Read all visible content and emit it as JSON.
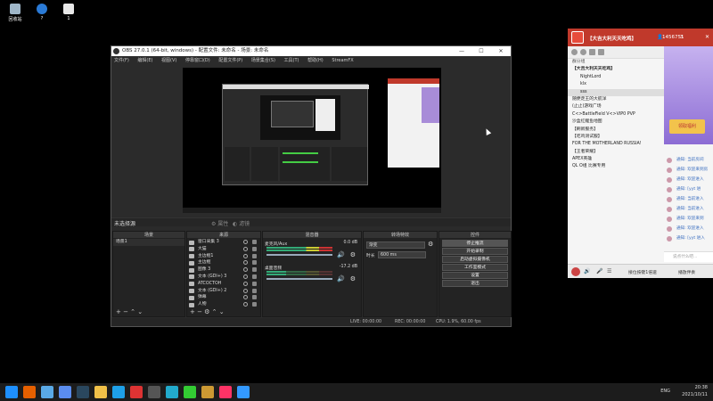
{
  "desktop": {
    "icons": [
      {
        "label": "回收站",
        "icon": "recycle-bin-icon",
        "color": "#9fb6c8"
      },
      {
        "label": "?",
        "icon": "help-icon",
        "color": "#2a7ad6"
      },
      {
        "label": "1",
        "icon": "file-icon",
        "color": "#e8e8e8"
      }
    ]
  },
  "obs": {
    "title": "OBS 27.0.1 (64-bit, windows) - 配置文件: 未命名 - 场景: 未命名",
    "window_controls": [
      "—",
      "☐",
      "✕"
    ],
    "menu": [
      "文件(F)",
      "编辑(E)",
      "视图(V)",
      "停靠窗口(D)",
      "配置文件(P)",
      "场景集合(S)",
      "工具(T)",
      "帮助(H)",
      "StreamFX"
    ],
    "status_bar_label": "未选择源",
    "prop_button": "属性",
    "filter_button": "滤镜",
    "docks": {
      "scenes": {
        "title": "场景",
        "items": [
          "场景1"
        ]
      },
      "sources": {
        "title": "来源",
        "items": [
          "窗口采集 3",
          "大猫",
          "主边框1",
          "主边框",
          "图像 3",
          "文本 (GDI+) 3",
          "ATCOCTOH",
          "文本 (GDI+) 2",
          "弹幕",
          "人物"
        ]
      },
      "mixer": {
        "title": "混音器",
        "channels": [
          {
            "name": "麦克风/Aux",
            "db": "0.0 dB"
          },
          {
            "name": "桌面音频",
            "db": "-17.2 dB"
          }
        ]
      },
      "transitions": {
        "title": "转场特效",
        "type": "渐变",
        "duration_label": "时长",
        "duration": "600 ms"
      },
      "controls": {
        "title": "控件",
        "buttons": [
          "停止推流",
          "开始录制",
          "启动虚拟摄像机",
          "工作室模式",
          "设置",
          "退出"
        ]
      }
    },
    "status": {
      "live": "LIVE: 00:00:00",
      "rec": "REC: 00:00:00",
      "cpu": "CPU: 1.9%, 60.00 fps"
    }
  },
  "qq": {
    "title": "【大吉大利天天吃鸡】",
    "member_count": "1456751",
    "online": "3",
    "section_label": "群分组",
    "members_header": "【大吉大利天天吃鸡】",
    "members": [
      "NightLord",
      "klx",
      "sss"
    ],
    "channels": [
      "随便走王的大航洋",
      "(止止)游戏广场",
      "C<>BattleField V<>VIP0 PVP",
      "沙盒红鲤鱼地图",
      "【刷新服务】",
      "【吃鸡测试服】",
      "FOR THE MOTHERLAND RUSSIA!",
      "【王者荣耀】",
      "APEX英雄",
      "QL O组 比赛专用"
    ],
    "chat": [
      "通知: 当前房间",
      "通知: 欢迎来到房",
      "通知: 欢迎进入",
      "通知: [yyt 进",
      "通知: 当前进入",
      "通知: 当前进入",
      "通知: 欢迎来到",
      "通知: 欢迎进入",
      "通知: [yyt 进入"
    ],
    "promo_label": "领取福利",
    "input_placeholder": "说点什么吧...",
    "footer": {
      "left": "接位按键1倍速",
      "right": "播放伴奏"
    }
  },
  "taskbar": {
    "apps": [
      {
        "icon": "windows-icon",
        "color": "#1e90ff"
      },
      {
        "icon": "firefox-icon",
        "color": "#e66000"
      },
      {
        "icon": "browser-icon",
        "color": "#5aa9e6"
      },
      {
        "icon": "files-icon",
        "color": "#5b8def"
      },
      {
        "icon": "steam-icon",
        "color": "#2a475e"
      },
      {
        "icon": "folder-icon",
        "color": "#f0c048"
      },
      {
        "icon": "qq-icon",
        "color": "#1ea0e8"
      },
      {
        "icon": "netease-icon",
        "color": "#d33"
      },
      {
        "icon": "obs-icon",
        "color": "#555"
      },
      {
        "icon": "app-icon",
        "color": "#2ac"
      },
      {
        "icon": "play-icon",
        "color": "#3c3"
      },
      {
        "icon": "game-icon",
        "color": "#c93"
      },
      {
        "icon": "orange-app-icon",
        "color": "#f36"
      },
      {
        "icon": "tool-icon",
        "color": "#39f"
      }
    ],
    "lang": "ENG",
    "time": "20:38",
    "date": "2021/10/11"
  }
}
